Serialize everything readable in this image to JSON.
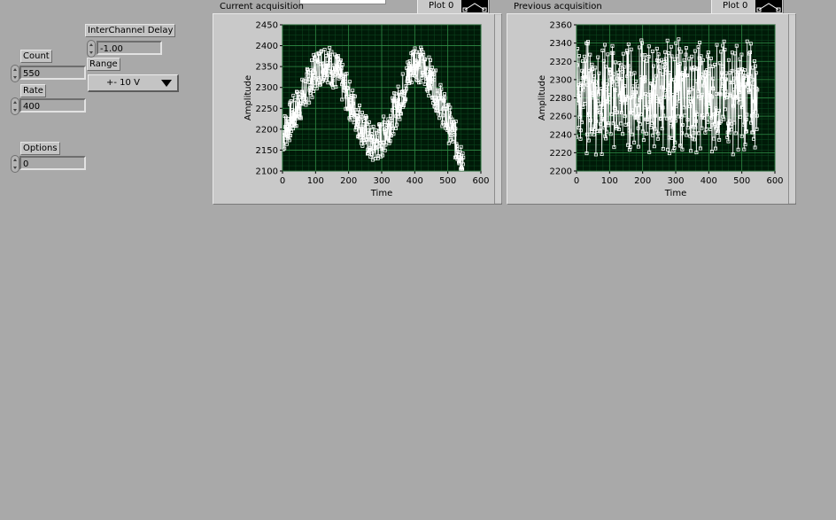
{
  "controls": {
    "count": {
      "label": "Count",
      "value": "550"
    },
    "rate": {
      "label": "Rate",
      "value": "400"
    },
    "options": {
      "label": "Options",
      "value": "0"
    },
    "interchannel_delay": {
      "label": "InterChannel Delay",
      "value": "-1.00"
    },
    "range": {
      "label": "Range",
      "value": "+- 10 V"
    }
  },
  "graphs": [
    {
      "title": "Current acquisition",
      "legend": "Plot 0",
      "chart_data": {
        "type": "scatter",
        "title": "",
        "xlabel": "Time",
        "ylabel": "Amplitude",
        "xlim": [
          0,
          600
        ],
        "ylim": [
          2100,
          2450
        ],
        "x_ticks": [
          "0",
          "100",
          "200",
          "300",
          "400",
          "500",
          "600"
        ],
        "y_ticks": [
          "2100",
          "2150",
          "2200",
          "2250",
          "2300",
          "2350",
          "2400",
          "2450"
        ],
        "grid": true,
        "series_shape": "sine-like oscillation, peaks near x=130 and x=400, troughs near x=270 and x=540, band width ~80",
        "series": [
          {
            "values_center": [
              [
                0,
                2185
              ],
              [
                50,
                2260
              ],
              [
                100,
                2340
              ],
              [
                130,
                2365
              ],
              [
                170,
                2330
              ],
              [
                220,
                2240
              ],
              [
                270,
                2160
              ],
              [
                300,
                2175
              ],
              [
                350,
                2260
              ],
              [
                400,
                2370
              ],
              [
                450,
                2320
              ],
              [
                500,
                2220
              ],
              [
                540,
                2140
              ],
              [
                548,
                2130
              ]
            ]
          }
        ]
      }
    },
    {
      "title": "Previous acquisition",
      "legend": "Plot 0",
      "chart_data": {
        "type": "scatter",
        "title": "",
        "xlabel": "Time",
        "ylabel": "Amplitude",
        "xlim": [
          0,
          600
        ],
        "ylim": [
          2200,
          2360
        ],
        "x_ticks": [
          "0",
          "100",
          "200",
          "300",
          "400",
          "500",
          "600"
        ],
        "y_ticks": [
          "2200",
          "2220",
          "2240",
          "2260",
          "2280",
          "2300",
          "2320",
          "2340",
          "2360"
        ],
        "grid": true,
        "series_shape": "dense noise band, values roughly uniformly spread between 2215 and 2350 over x=0..548",
        "series": [
          {
            "value_band": [
              2215,
              2350
            ],
            "x_range": [
              0,
              548
            ]
          }
        ]
      }
    }
  ]
}
